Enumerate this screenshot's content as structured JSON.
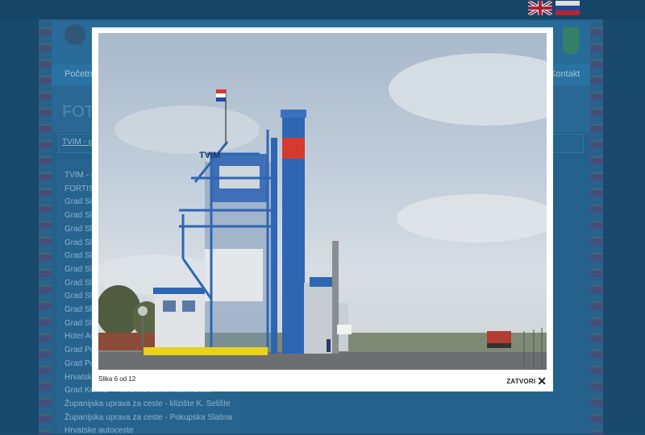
{
  "site": {
    "nav_first": "Početna",
    "nav_last": "Kontakt",
    "page_title": "FOTO",
    "breadcrumb": "TVIM - gal",
    "sidebar_items": [
      "TVIM - a",
      "FORTIS",
      "Grad Si",
      "Grad Sl",
      "Grad Sl",
      "Grad Sl",
      "Grad Sl",
      "Grad Si",
      "Grad Sl",
      "Grad Sl",
      "Grad Sl",
      "Grad Sl",
      "Hotel As",
      "Grad Po",
      "Grad Po",
      "Hrvatski",
      "Grad Kutina - Poslovna zona Kutinčanka",
      "Županijska uprava za ceste - klizište K. Selište",
      "Županijska uprava za ceste - Pokupska Slatina",
      "Hrvatske autoceste"
    ]
  },
  "lightbox": {
    "counter": "Slika 6 od 12",
    "close_label": "ZATVORI",
    "close_icon": "close-x-icon",
    "photo_sign": "TVIM"
  },
  "colors": {
    "page_bg": "#1d4f73",
    "plant_blue": "#2e66b4",
    "chimney_red": "#d53a2e",
    "safety_yellow": "#e8d21a"
  },
  "flags": [
    "english-flag-icon",
    "russian-flag-icon"
  ]
}
